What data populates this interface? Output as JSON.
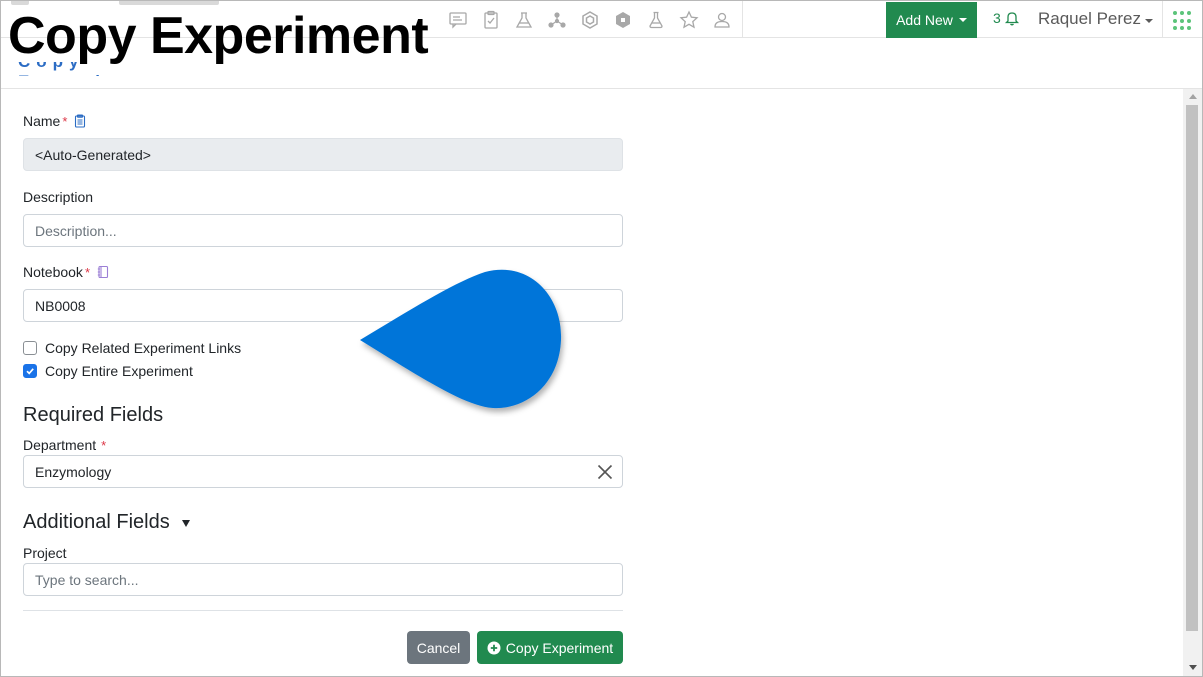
{
  "header": {
    "title": "Copy Experiment",
    "nav_icons": [
      "chat-sheet-icon",
      "clipboard-check-icon",
      "lab-flask-icon",
      "molecule-icon",
      "hexagon-compound-icon",
      "shield-hex-icon",
      "flask-icon",
      "star-icon",
      "user-outline-icon"
    ],
    "add_new_label": "Add New",
    "notification_count": "3",
    "user_name": "Raquel Perez"
  },
  "form": {
    "name": {
      "label": "Name",
      "value": "<Auto-Generated>"
    },
    "description": {
      "label": "Description",
      "placeholder": "Description..."
    },
    "notebook": {
      "label": "Notebook",
      "value": "NB0008"
    },
    "checkboxes": [
      {
        "label": "Copy Related Experiment Links",
        "checked": false
      },
      {
        "label": "Copy Entire Experiment",
        "checked": true
      }
    ],
    "required_section": "Required Fields",
    "department": {
      "label": "Department",
      "value": "Enzymology"
    },
    "additional_section": "Additional Fields",
    "project": {
      "label": "Project",
      "placeholder": "Type to search..."
    },
    "required_marker": "*"
  },
  "actions": {
    "cancel_label": "Cancel",
    "copy_label": "Copy Experiment"
  },
  "colors": {
    "brand_green": "#218a4f",
    "checkbox_blue": "#1a73e8",
    "cancel_gray": "#6c757d",
    "pointer_blue": "#0074d9",
    "required_red": "#dc3545"
  }
}
